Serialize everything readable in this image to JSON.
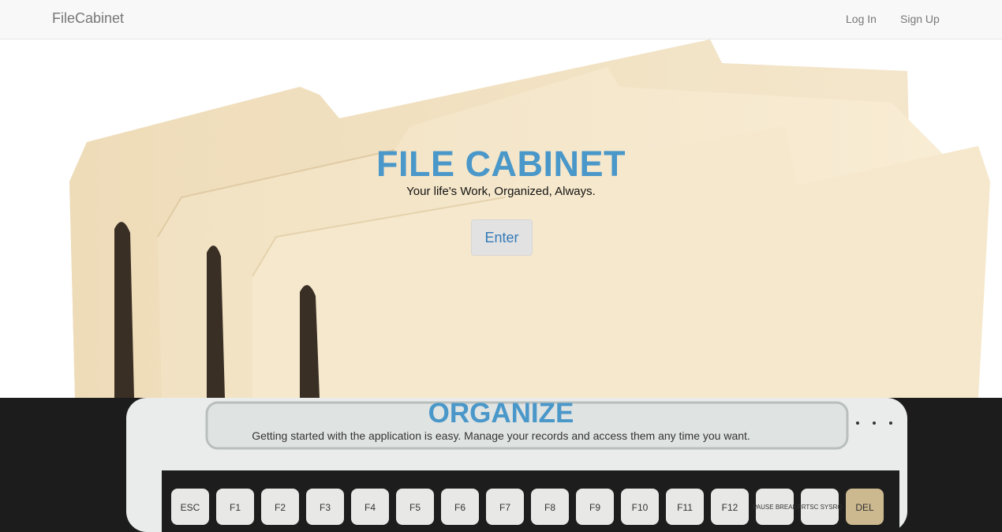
{
  "navbar": {
    "brand": "FileCabinet",
    "links": [
      {
        "label": "Log In"
      },
      {
        "label": "Sign Up"
      }
    ]
  },
  "hero": {
    "title": "FILE CABINET",
    "subtitle": "Your life's Work, Organized, Always.",
    "enter_label": "Enter"
  },
  "organize": {
    "title": "ORGANIZE",
    "text": "Getting started with the application is easy. Manage your records and access them any time you want."
  },
  "keyboard": {
    "keys": [
      "ESC",
      "F1",
      "F2",
      "F3",
      "F4",
      "F5",
      "F6",
      "F7",
      "F8",
      "F9",
      "F10",
      "F11",
      "F12",
      "PAUSE BREAK",
      "PRTSC SYSRQ",
      "DEL"
    ]
  },
  "colors": {
    "accent": "#4a97c9",
    "link": "#337ab7",
    "navbar_bg": "#f8f8f8",
    "folder": "#f5e6c8",
    "dark_bg": "#1c1c1c"
  }
}
